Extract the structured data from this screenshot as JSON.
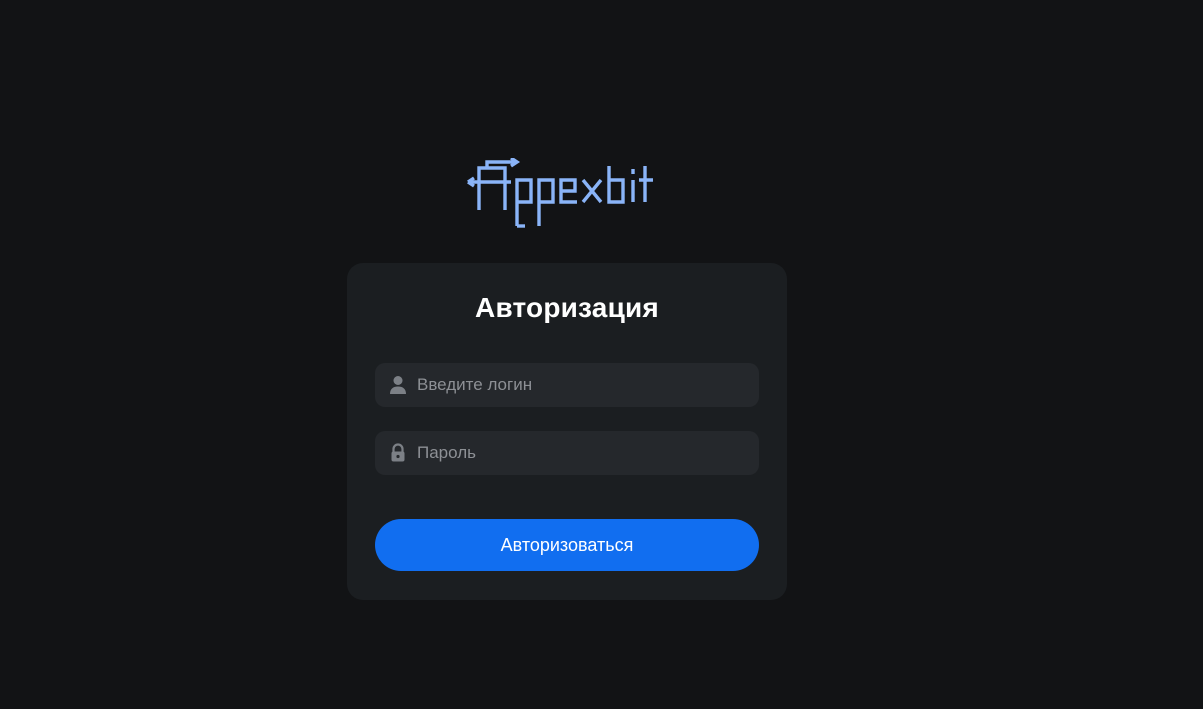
{
  "brand": {
    "logo_text": "Appexbit",
    "logo_color": "#8ab4f8"
  },
  "auth": {
    "title": "Авторизация",
    "login_placeholder": "Введите логин",
    "login_value": "",
    "password_placeholder": "Пароль",
    "password_value": "",
    "submit_label": "Авторизоваться"
  },
  "icons": {
    "login": "user-icon",
    "password": "lock-icon"
  },
  "colors": {
    "background": "#121315",
    "card": "#1b1e21",
    "field": "#25282c",
    "accent": "#116ef0",
    "placeholder": "#8d9095"
  }
}
